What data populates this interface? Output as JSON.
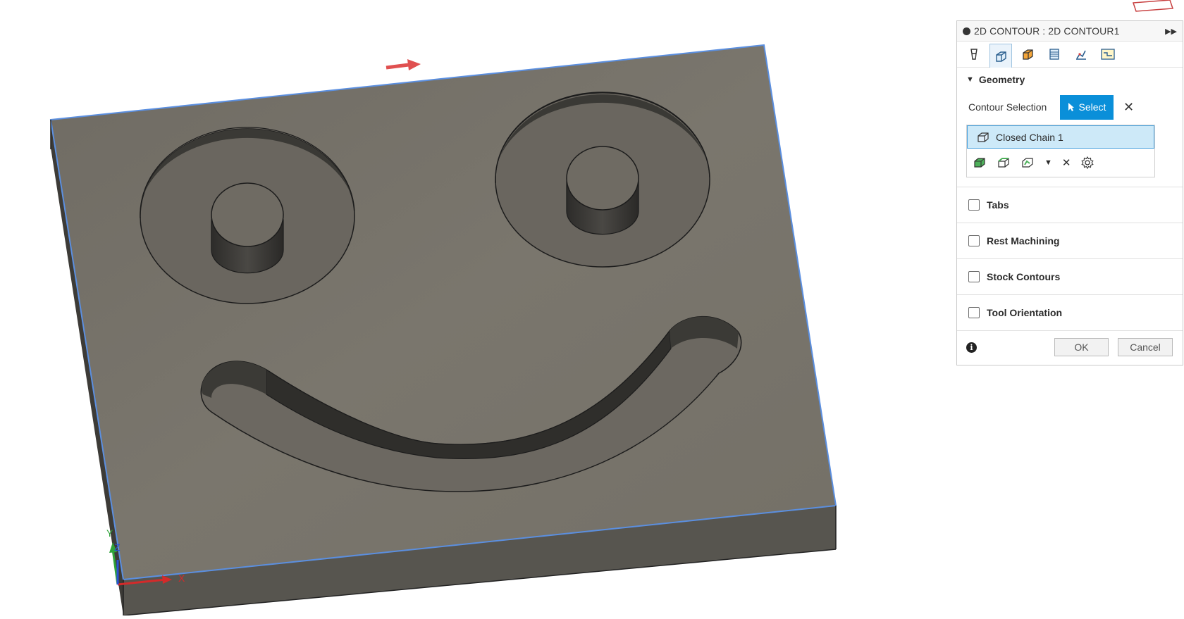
{
  "panel": {
    "title": "2D CONTOUR : 2D CONTOUR1",
    "expand_icon": "double-chevron-right-icon",
    "tabs": [
      "tool-tab",
      "geometry-tab",
      "heights-tab",
      "passes-tab",
      "linking-tab",
      "simulation-tab"
    ],
    "geometry": {
      "heading": "Geometry",
      "contour_selection_label": "Contour Selection",
      "select_label": "Select",
      "chain_label": "Closed Chain 1"
    },
    "sections": [
      "Tabs",
      "Rest Machining",
      "Stock Contours",
      "Tool Orientation"
    ],
    "ok_label": "OK",
    "cancel_label": "Cancel"
  },
  "axes": {
    "x": "X",
    "y": "Y",
    "z": "Z"
  },
  "colors": {
    "accent": "#0a8fd9",
    "selection": "#cde9f8",
    "edge_highlight": "#5b8fe0",
    "stock_top": "#76716a"
  }
}
